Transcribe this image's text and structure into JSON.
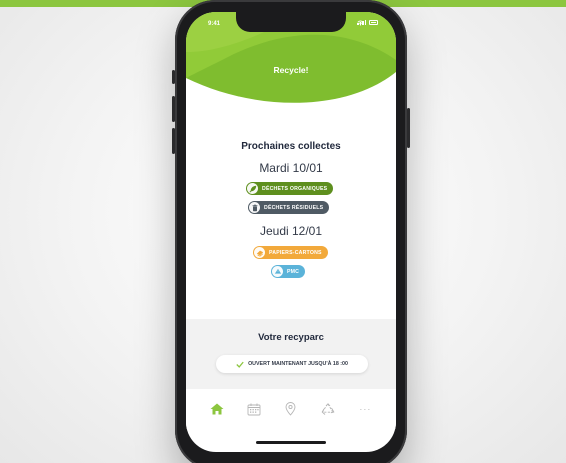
{
  "status_bar": {
    "time": "9:41"
  },
  "app": {
    "title": "Recycle!"
  },
  "collections": {
    "title": "Prochaines collectes",
    "days": [
      {
        "label": "Mardi 10/01",
        "items": [
          {
            "label": "DÉCHETS ORGANIQUES",
            "color": "#5e8f1e",
            "icon": "organic-waste-icon"
          },
          {
            "label": "DÉCHETS RÉSIDUELS",
            "color": "#4f5a64",
            "icon": "residual-waste-icon"
          }
        ]
      },
      {
        "label": "Jeudi 12/01",
        "items": [
          {
            "label": "PAPIERS-CARTONS",
            "color": "#f2a93b",
            "icon": "paper-cardboard-icon"
          },
          {
            "label": "PMC",
            "color": "#5bb3d9",
            "icon": "pmc-icon"
          }
        ]
      }
    ]
  },
  "recyparc": {
    "title": "Votre recyparc",
    "status": "OUVERT MAINTENANT JUSQU'À 18 :00"
  },
  "tabbar": {
    "items": [
      {
        "name": "home",
        "icon": "home-icon",
        "active": true
      },
      {
        "name": "calendar",
        "icon": "calendar-icon",
        "active": false
      },
      {
        "name": "map",
        "icon": "location-pin-icon",
        "active": false
      },
      {
        "name": "recycle",
        "icon": "recycle-icon",
        "active": false
      },
      {
        "name": "more",
        "label": "···",
        "icon": "more-icon",
        "active": false
      }
    ]
  },
  "colors": {
    "brand_green": "#8cc63f",
    "dark_text": "#222a3d",
    "active_tab": "#8cc63f",
    "inactive_tab": "#b5b5b5"
  }
}
